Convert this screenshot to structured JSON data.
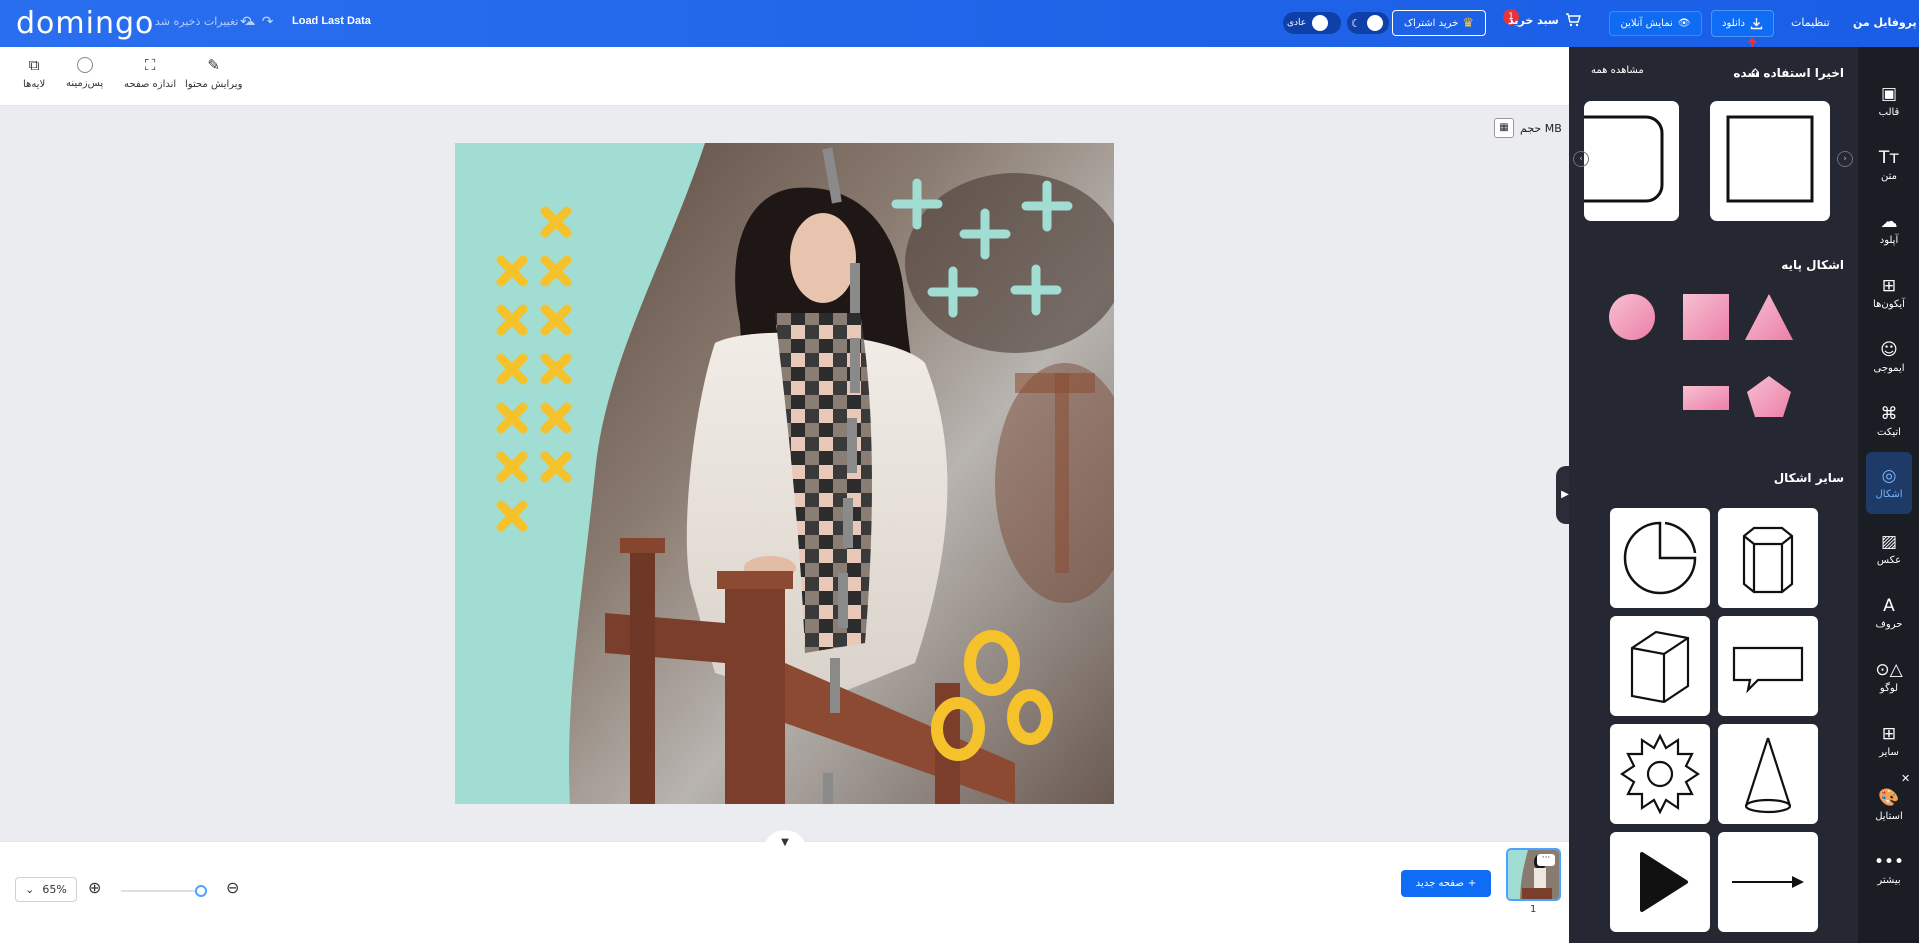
{
  "header": {
    "logo": "domingo",
    "saved_status": "تغییرات ذخیره شد",
    "load_last": "Load Last Data",
    "mode_label": "عادی",
    "subscription_label": "خرید اشتراک",
    "cart_label": "سبد خرید",
    "cart_badge": "1",
    "preview_label": "نمایش آنلاین",
    "download_label": "دانلود",
    "settings_label": "تنظیمات",
    "profile_label": "پروفایل من"
  },
  "toolbar": {
    "edit_content": "ویرایش محتوا",
    "page_size": "اندازه صفحه",
    "background": "پس‌زمینه",
    "layers": "لایه‌ها"
  },
  "canvas": {
    "size_label": "حجم MB"
  },
  "bottom": {
    "zoom_value": "65%",
    "new_page": "صفحه جدید",
    "page_number": "1"
  },
  "panel": {
    "recent_title": "اخیرا استفاده شده",
    "see_all": "مشاهده همه",
    "basic_shapes_title": "اشکال پایه",
    "other_shapes_title": "سایر اشکال"
  },
  "rail": {
    "items": [
      {
        "label": "قالب",
        "icon": "template-icon"
      },
      {
        "label": "متن",
        "icon": "text-icon"
      },
      {
        "label": "آپلود",
        "icon": "upload-icon"
      },
      {
        "label": "آیکون‌ها",
        "icon": "icons-icon"
      },
      {
        "label": "ایموجی",
        "icon": "emoji-icon"
      },
      {
        "label": "اتیکت",
        "icon": "tag-icon"
      },
      {
        "label": "اشکال",
        "icon": "shapes-icon"
      },
      {
        "label": "عکس",
        "icon": "photo-icon"
      },
      {
        "label": "حروف",
        "icon": "letters-icon"
      },
      {
        "label": "لوگو",
        "icon": "logo-icon"
      },
      {
        "label": "سایر",
        "icon": "other-icon"
      },
      {
        "label": "استایل",
        "icon": "style-icon"
      },
      {
        "label": "بیشتر",
        "icon": "more-icon"
      }
    ]
  },
  "colors": {
    "header_blue": "#1f63e8",
    "panel_dark": "#252833",
    "rail_dark": "#1b1d25",
    "mint": "#a2ddd4",
    "yellow": "#f6c22b",
    "pink": "#f193b5"
  }
}
